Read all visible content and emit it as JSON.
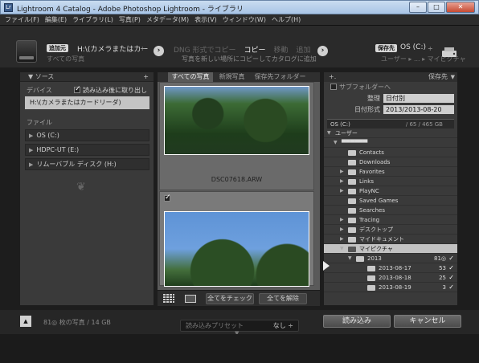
{
  "window": {
    "title": "Lightroom 4 Catalog - Adobe Photoshop Lightroom - ライブラリ",
    "minimize": "–",
    "maximize": "□",
    "close": "✕"
  },
  "menu": [
    "ファイル(F)",
    "編集(E)",
    "ライブラリ(L)",
    "写真(P)",
    "メタデータ(M)",
    "表示(V)",
    "ウィンドウ(W)",
    "ヘルプ(H)"
  ],
  "header": {
    "source_badge": "追加元",
    "source_name": "H:\\(カメラまたはカー",
    "source_dropdown": "÷",
    "source_sub": "すべての写真",
    "modes": [
      "DNG 形式でコピー",
      "コピー",
      "移動",
      "追加"
    ],
    "active_mode": 1,
    "mode_desc": "写真を新しい場所にコピーしてカタログに追加",
    "dest_badge": "保存先",
    "dest_name": "OS (C:)",
    "dest_dropdown": "÷",
    "dest_sub": "ユーザー ▸ ... ▸ マイピクチャ"
  },
  "left_panel": {
    "title": "ソース",
    "plus": "+",
    "device_label": "デバイス",
    "eject_label": "読み込み後に取り出し",
    "eject_checked": true,
    "device_name": "H:\\(カメラまたはカードリーダ)",
    "files_label": "ファイル",
    "drives": [
      "OS (C:)",
      "HDPC-UT (E:)",
      "リムーバブル ディスク (H:)"
    ]
  },
  "center": {
    "tabs": [
      "すべての写真",
      "新規写真",
      "保存先フォルダー"
    ],
    "active_tab": 0,
    "photos": [
      {
        "filename": "DSC07618.ARW",
        "checked": true
      },
      {
        "filename": "",
        "checked": true
      }
    ],
    "check_all": "全てをチェック",
    "uncheck_all": "全てを解除"
  },
  "right_panel": {
    "plus": "+.",
    "title": "保存先",
    "subfolder_label": "サブフォルダーへ",
    "organize_label": "整理",
    "organize_value": "日付別",
    "date_format_label": "日付形式",
    "date_format_value": "2013/2013-08-20",
    "volume_name": "OS (C:)",
    "volume_capacity": "/ 65 / 465 GB",
    "tree": [
      {
        "name": "ユーザー",
        "indent": 4,
        "tri": "▼",
        "folder": false
      },
      {
        "name": "▀▀▀▀▀▀",
        "indent": 12,
        "tri": "▼",
        "folder": false
      },
      {
        "name": "Contacts",
        "indent": 20,
        "tri": "",
        "folder": true
      },
      {
        "name": "Downloads",
        "indent": 20,
        "tri": "",
        "folder": true
      },
      {
        "name": "Favorites",
        "indent": 20,
        "tri": "▶",
        "folder": true
      },
      {
        "name": "Links",
        "indent": 20,
        "tri": "▶",
        "folder": true
      },
      {
        "name": "PlayNC",
        "indent": 20,
        "tri": "▶",
        "folder": true
      },
      {
        "name": "Saved Games",
        "indent": 20,
        "tri": "",
        "folder": true
      },
      {
        "name": "Searches",
        "indent": 20,
        "tri": "",
        "folder": true
      },
      {
        "name": "Tracing",
        "indent": 20,
        "tri": "▶",
        "folder": true
      },
      {
        "name": "デスクトップ",
        "indent": 20,
        "tri": "▶",
        "folder": true
      },
      {
        "name": "マイドキュメント",
        "indent": 20,
        "tri": "▶",
        "folder": true
      },
      {
        "name": "マイピクチャ",
        "indent": 20,
        "tri": "▼",
        "folder": true,
        "selected": true
      },
      {
        "name": "2013",
        "indent": 30,
        "tri": "▼",
        "folder": true,
        "count": "81◎",
        "check": true
      },
      {
        "name": "2013-08-17",
        "indent": 44,
        "tri": "",
        "folder": true,
        "count": "53",
        "check": true
      },
      {
        "name": "2013-08-18",
        "indent": 44,
        "tri": "",
        "folder": true,
        "count": "25",
        "check": true
      },
      {
        "name": "2013-08-19",
        "indent": 44,
        "tri": "",
        "folder": true,
        "count": "3",
        "check": true
      }
    ]
  },
  "footer": {
    "info": "81◎ 枚の写真 / 14 GB",
    "preset_label": "読み込みプリセット",
    "preset_value": "なし ÷",
    "import_button": "読み込み",
    "cancel_button": "キャンセル"
  }
}
